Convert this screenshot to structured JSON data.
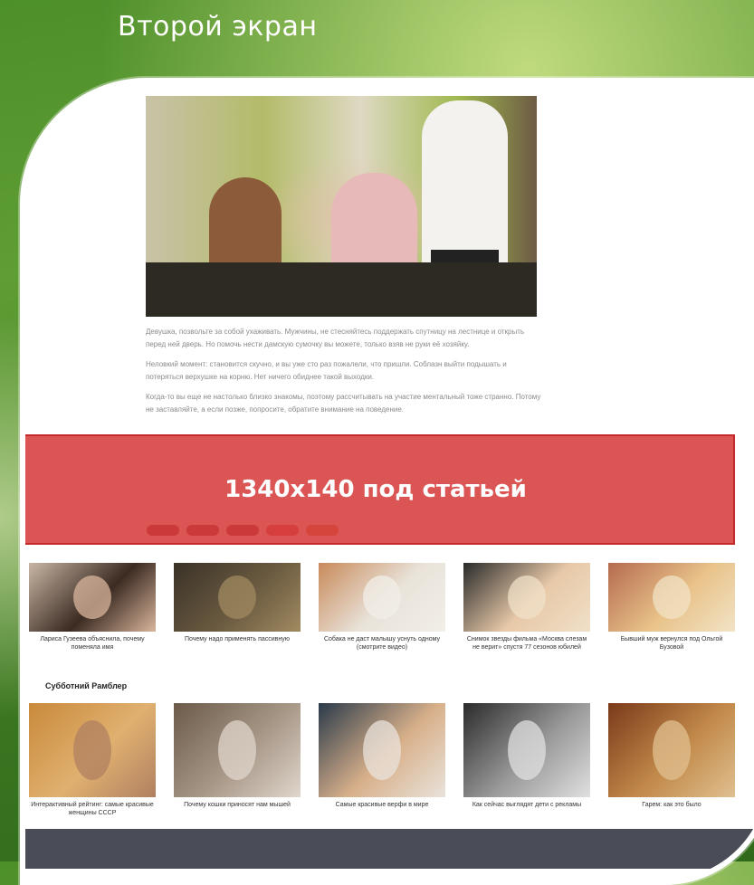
{
  "slide": {
    "title": "Второй экран"
  },
  "article": {
    "paragraphs": [
      "Девушка, позвольте за собой ухаживать. Мужчины, не стесняйтесь поддержать спутницу на лестнице и открыть перед ней дверь. Но помочь нести дамскую сумочку вы можете, только взяв не руки её хозяйку.",
      "Неловкий момент: становится скучно, и вы уже сто раз пожалели, что пришли. Соблазн выйти подышать и потеряться верхушке на корню. Нет ничего обиднее такой выходки.",
      "Когда-то вы еще не настолько близко знакомы, поэтому рассчитывать на участие ментальный тоже странно. Потому не заставляйте, а если позже, попросите, обратите внимание на поведение."
    ],
    "share_colors": [
      "#7a1f2a",
      "#7a1f2a",
      "#7a1f2a",
      "#d24a3a",
      "#d27a2a"
    ]
  },
  "banner": {
    "label": "1340x140 под статьей"
  },
  "related": [
    {
      "caption": "Лариса Гузеева объяснила, почему поменяла имя",
      "colors": [
        "#c9b6a5",
        "#3b2b22",
        "#d9b59c"
      ]
    },
    {
      "caption": "Почему надо применять пассивную",
      "colors": [
        "#3a3228",
        "#6a5a40",
        "#a08a60"
      ]
    },
    {
      "caption": "Собака не даст малышу уснуть одному (смотрите видео)",
      "colors": [
        "#c88a5a",
        "#e9e3da",
        "#f2efe8"
      ]
    },
    {
      "caption": "Снимок звезды фильма «Москва слезам не верит» спустя 77 сезонов юбилей",
      "colors": [
        "#2a2a2a",
        "#e7c9a8",
        "#f0e0c8"
      ]
    },
    {
      "caption": "Бывший муж вернулся под Ольгой Бузовой",
      "colors": [
        "#b56a4e",
        "#e9c38a",
        "#f2e3c6"
      ]
    }
  ],
  "rambler": {
    "title": "Субботний Рамблер",
    "items": [
      {
        "caption": "Интерактивный рейтинг: самые красивые женщины СССР",
        "colors": [
          "#c98a3a",
          "#e0b070",
          "#b08060"
        ]
      },
      {
        "caption": "Почему кошки приносят нам мышей",
        "colors": [
          "#6b5a4a",
          "#a89888",
          "#e0d6cc"
        ]
      },
      {
        "caption": "Самые красивые верфи в мире",
        "colors": [
          "#2a3a4a",
          "#d8b08a",
          "#e9e3dc"
        ]
      },
      {
        "caption": "Как сейчас выглядят дети с рекламы",
        "colors": [
          "#2b2b2b",
          "#9a9a9a",
          "#e0e0e0"
        ]
      },
      {
        "caption": "Гарем: как это было",
        "colors": [
          "#7a3a1a",
          "#c28a4a",
          "#e0c090"
        ]
      }
    ]
  }
}
